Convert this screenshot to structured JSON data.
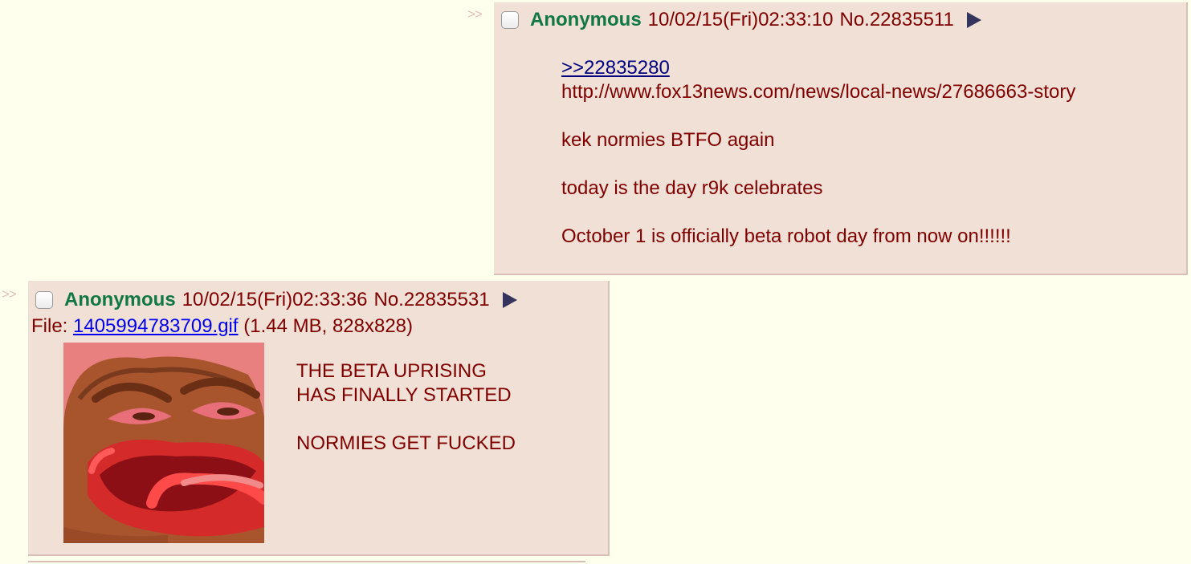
{
  "post1": {
    "arrows": ">>",
    "name": "Anonymous",
    "datetime": "10/02/15(Fri)02:33:10",
    "postnum": "No.22835511",
    "quote_link": ">>22835280",
    "lines": [
      "http://www.fox13news.com/news/local-news/27686663-story",
      "kek normies BTFO again",
      "today is the day r9k celebrates",
      "October 1 is officially beta robot day from now on!!!!!!"
    ]
  },
  "post2": {
    "arrows": ">>",
    "name": "Anonymous",
    "datetime": "10/02/15(Fri)02:33:36",
    "postnum": "No.22835531",
    "file_label": "File:",
    "file_name": "1405994783709.gif",
    "file_info": "(1.44 MB, 828x828)",
    "lines": [
      "THE BETA UPRISING",
      "HAS FINALLY STARTED",
      "NORMIES GET FUCKED"
    ]
  },
  "colors": {
    "background": "#ffffee",
    "post_bg": "#f0e0d6",
    "border": "#d9bfb7",
    "name": "#117743",
    "text": "#800000",
    "quote_link": "#000080",
    "file_link": "#0000ee",
    "menu_arrow": "#34345c"
  },
  "icons": {
    "menu": "triangle-right",
    "select": "checkbox"
  }
}
